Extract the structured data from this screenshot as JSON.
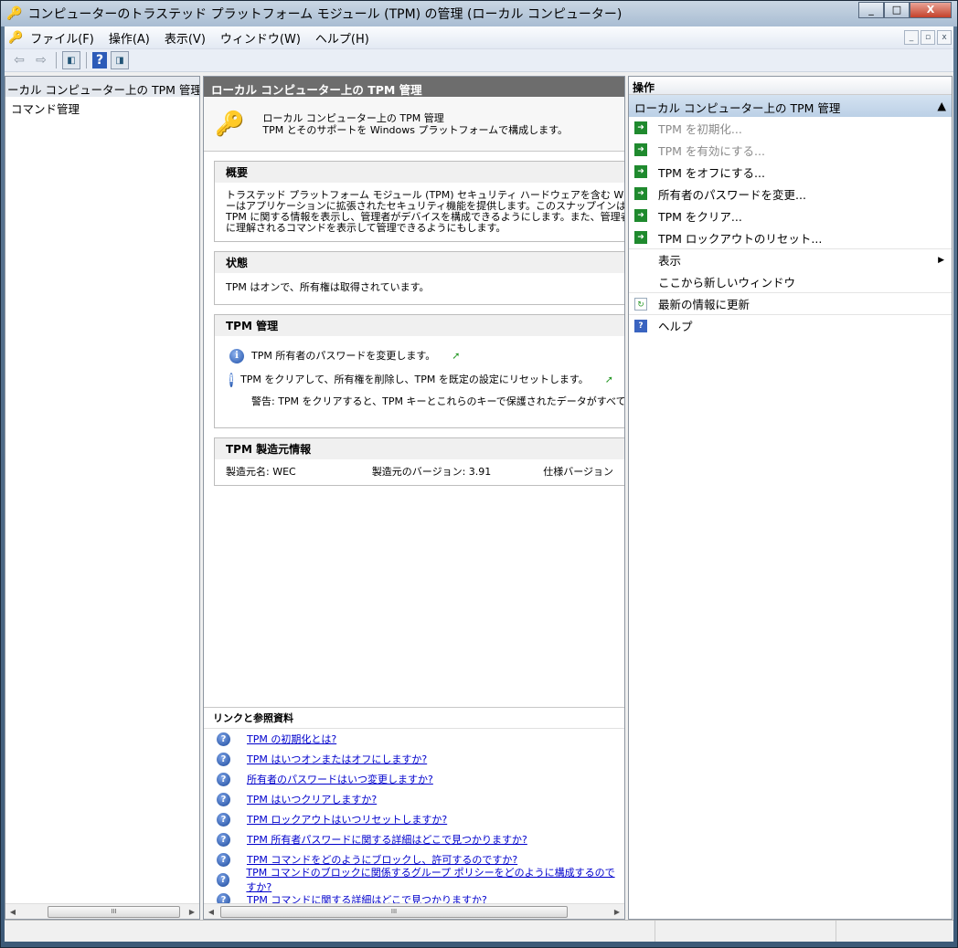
{
  "window": {
    "title": "コンピューターのトラステッド プラットフォーム モジュール (TPM) の管理 (ローカル コンピューター)",
    "min": "_",
    "max": "□",
    "close": "X"
  },
  "menu": [
    "ファイル(F)",
    "操作(A)",
    "表示(V)",
    "ウィンドウ(W)",
    "ヘルプ(H)"
  ],
  "mdi": [
    "_",
    "▫",
    "x"
  ],
  "tree": {
    "header": "ーカル コンピューター上の TPM 管理",
    "items": [
      "コマンド管理"
    ]
  },
  "main": {
    "header": "ローカル コンピューター上の TPM 管理",
    "intro": [
      "ローカル コンピューター上の TPM 管理",
      "TPM とそのサポートを Windows プラットフォームで構成します。"
    ],
    "overview": {
      "title": "概要",
      "lines": [
        "トラステッド プラットフォーム モジュール (TPM) セキュリティ ハードウェアを含む Windows コンピュ",
        "ーはアプリケーションに拡張されたセキュリティ機能を提供します。このスナップインは、コンピュータ",
        "TPM に関する情報を表示し、管理者がデバイスを構成できるようにします。また、管理者がデバ",
        "に理解されるコマンドを表示して管理できるようにもします。"
      ]
    },
    "status": {
      "title": "状態",
      "text": "TPM はオンで、所有権は取得されています。"
    },
    "manage": {
      "title": "TPM 管理",
      "items": [
        "TPM 所有者のパスワードを変更します。",
        "TPM をクリアして、所有権を削除し、TPM を既定の設定にリセットします。"
      ],
      "warning": "警告: TPM をクリアすると、TPM キーとこれらのキーで保護されたデータがすべて失われま"
    },
    "mfr": {
      "title": "TPM 製造元情報",
      "name": "製造元名: WEC",
      "version": "製造元のバージョン: 3.91",
      "spec": "仕様バージョン"
    },
    "links": {
      "title": "リンクと参照資料",
      "items": [
        "TPM の初期化とは?",
        "TPM はいつオンまたはオフにしますか?",
        "所有者のパスワードはいつ変更しますか?",
        "TPM はいつクリアしますか?",
        "TPM ロックアウトはいつリセットしますか?",
        "TPM 所有者パスワードに関する詳細はどこで見つかりますか?",
        "TPM コマンドをどのようにブロックし、許可するのですか?",
        "TPM コマンドのブロックに関係するグループ ポリシーをどのように構成するのですか?",
        "TPM コマンドに関する詳細はどこで見つかりますか?"
      ]
    }
  },
  "actions": {
    "header": "操作",
    "section": "ローカル コンピューター上の TPM 管理",
    "items": [
      {
        "label": "TPM を初期化...",
        "disabled": true
      },
      {
        "label": "TPM を有効にする...",
        "disabled": true
      },
      {
        "label": "TPM をオフにする..."
      },
      {
        "label": "所有者のパスワードを変更..."
      },
      {
        "label": "TPM をクリア..."
      },
      {
        "label": "TPM ロックアウトのリセット..."
      }
    ],
    "view": "表示",
    "new_window": "ここから新しいウィンドウ",
    "refresh": "最新の情報に更新",
    "help": "ヘルプ"
  },
  "scroll": "III"
}
